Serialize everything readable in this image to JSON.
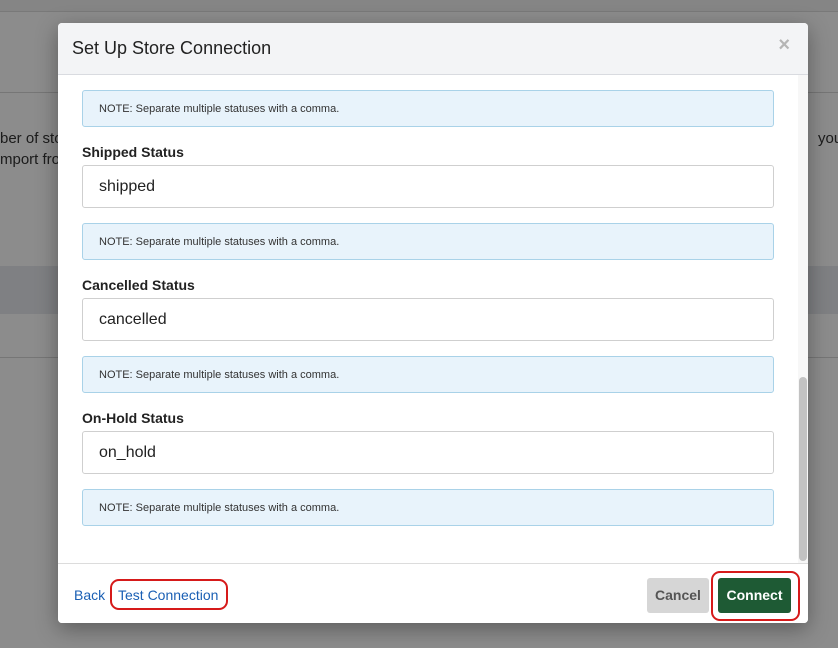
{
  "background": {
    "left_text_line1": "ber of sto",
    "left_text_line2": "mport fro",
    "right_text": "you c"
  },
  "modal": {
    "title": "Set Up Store Connection",
    "close_glyph": "×",
    "note_text": "NOTE: Separate multiple statuses with a comma.",
    "fields": [
      {
        "label": "Shipped Status",
        "value": "shipped"
      },
      {
        "label": "Cancelled Status",
        "value": "cancelled"
      },
      {
        "label": "On-Hold Status",
        "value": "on_hold"
      }
    ]
  },
  "footer": {
    "back_label": "Back",
    "test_label": "Test Connection",
    "cancel_label": "Cancel",
    "connect_label": "Connect"
  },
  "colors": {
    "connect_button": "#1e5a34",
    "highlight_ring": "#d61a1a",
    "link": "#1a5fb4",
    "note_background": "#e8f3fb"
  }
}
